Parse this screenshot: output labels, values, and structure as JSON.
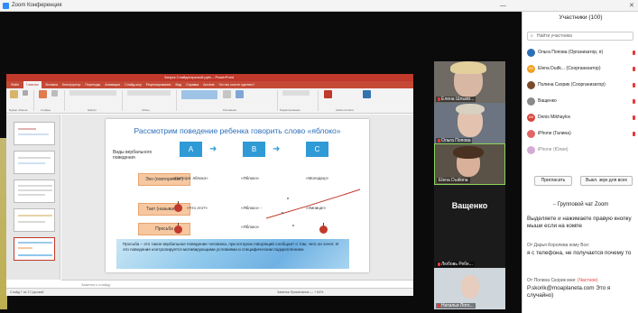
{
  "window": {
    "title": "Zoom Конференция",
    "minimize": "—",
    "close": "✕"
  },
  "ppt": {
    "title": "Запуск Слайдоткрытый.pptx – PowerPoint",
    "tabs": [
      "Файл",
      "Главная",
      "Вставка",
      "Конструктор",
      "Переходы",
      "Анимация",
      "Слайд-шоу",
      "Рецензирование",
      "Вид",
      "Справка",
      "Acrobat",
      "Что вы хотите сделать?"
    ],
    "ribbon_groups": [
      "Буфер обмена",
      "Слайды",
      "Шрифт",
      "Абзац",
      "Рисование",
      "Редактирование",
      "Adobe Acrobat"
    ],
    "notes_placeholder": "Заметки к слайду",
    "status_left": "Слайд 7 из 17   русский",
    "status_right": "Заметки   Примечания   —  +  64%"
  },
  "slide": {
    "title": "Рассмотрим поведение ребенка говорить слово «яблоко»",
    "subtitle": "Виды вербального поведения",
    "abc": [
      "A",
      "B",
      "C"
    ],
    "rows": [
      {
        "label": "Эхо (повторение )",
        "a": "«Повтори: яблоко»",
        "b": "«Яблоко»",
        "c": "«Молодец!»"
      },
      {
        "label": "Такт (называние)",
        "a": "«Что это?»",
        "b": "«Яблоко» -",
        "c": "«Умница!»"
      },
      {
        "label": "Просьба",
        "a": "",
        "b": "«Яблоко»",
        "c": ""
      }
    ],
    "box_text": "Просьба – это такое вербальное поведение человека, при котором говорящий сообщает о том, чего он хочет. И это поведение контролируется мотивирующими условиями и специфическим подкреплением"
  },
  "videos": [
    {
      "name": "Елена Шльмо...",
      "kind": "video"
    },
    {
      "name": "Ольга Попова",
      "kind": "video"
    },
    {
      "name": "Elena Dudkina",
      "kind": "video"
    },
    {
      "name": "Ващенко",
      "kind": "name"
    },
    {
      "name": "Любовь Ребе...",
      "kind": "blank"
    },
    {
      "name": "Наталья Лого...",
      "kind": "video"
    }
  ],
  "participants_panel": {
    "header": "Участники (100)",
    "search_placeholder": "Найти участника",
    "search_icon": "search-icon",
    "participants": [
      {
        "initials": "",
        "name": "Ольга Попова (Организатор, я)",
        "color": "#2d6fb6"
      },
      {
        "initials": "ED",
        "name": "Elena Dudk... (Соорганизатор)",
        "color": "#f0a020"
      },
      {
        "initials": "",
        "name": "Полина Скорик (Соорганизатор)",
        "color": "#7a4a2a"
      },
      {
        "initials": "",
        "name": "Ващенко",
        "color": "#8a8a8a"
      },
      {
        "initials": "DM",
        "name": "Denis Mikhaylov",
        "color": "#d9433a"
      },
      {
        "initials": "",
        "name": "iPhone (Галина)",
        "color": "#e06666"
      },
      {
        "initials": "",
        "name": "iPhone (Юлия)",
        "color": "#b06ab3"
      }
    ],
    "invite_label": "Пригласить",
    "mute_all_label": "Выкл. звук для всех",
    "chat_title": "Групповой чат Zoom",
    "messages": [
      {
        "meta": "",
        "text": "Выделяете и нажимаете правую кнопку мыши если на компе"
      },
      {
        "meta": "От Дарья Королева кому Все:",
        "text": "я с телефона, не получается почему то"
      },
      {
        "meta_from": "От Полина Скорик мне:",
        "meta_priv": "(Частное)",
        "text": "P.skorik@moaplaneta.com Это я случайно)"
      }
    ]
  }
}
